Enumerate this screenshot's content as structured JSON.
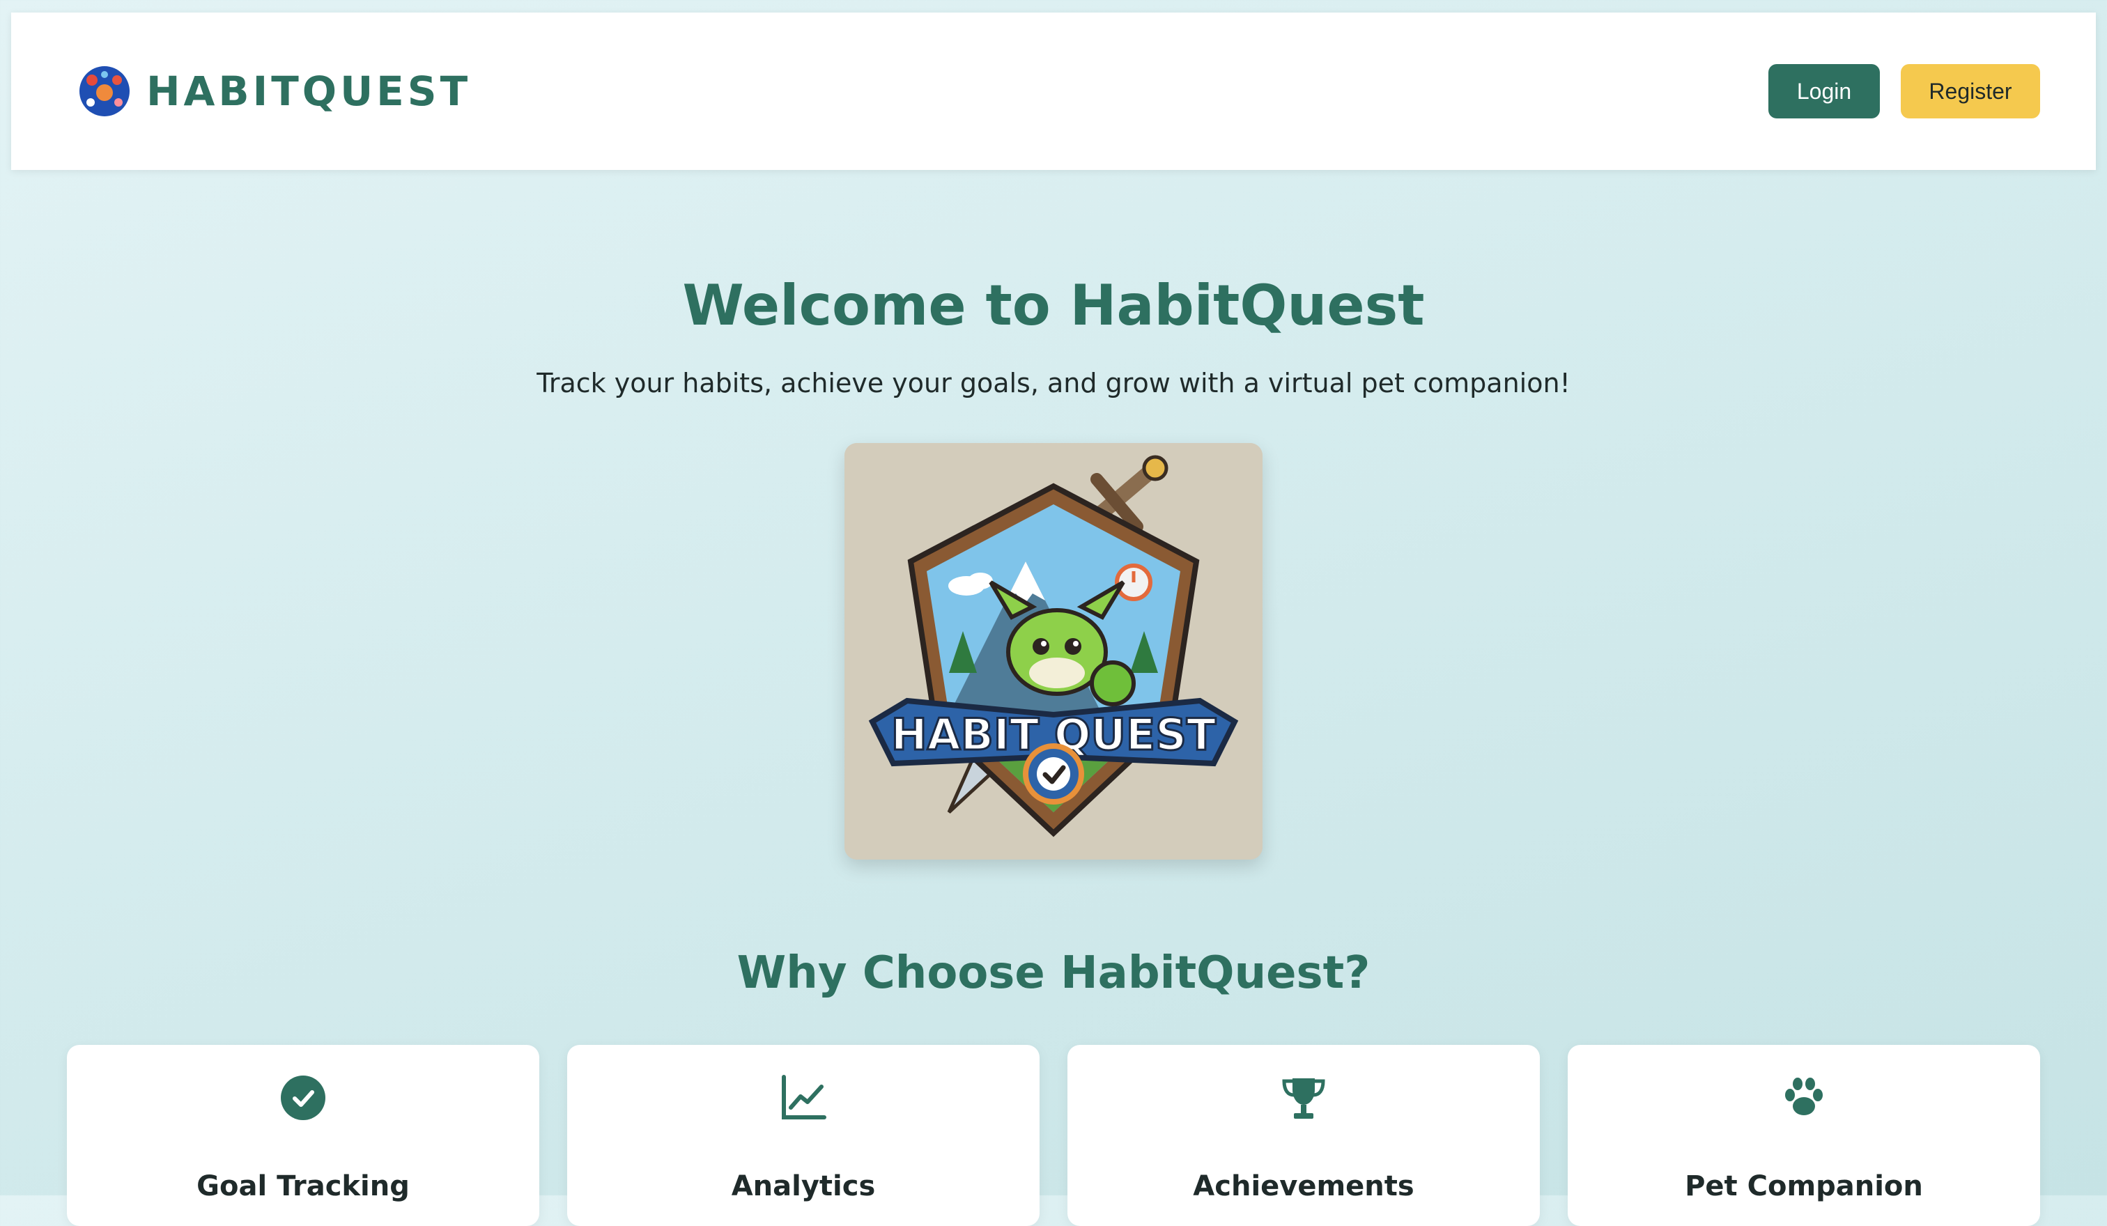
{
  "header": {
    "brand_name": "HABITQUEST",
    "login_label": "Login",
    "register_label": "Register"
  },
  "hero": {
    "title": "Welcome to HabitQuest",
    "subtitle": "Track your habits, achieve your goals, and grow with a virtual pet companion!",
    "logo_text": "HABIT QUEST",
    "logo_icon": "shield-emblem"
  },
  "features": {
    "title": "Why Choose HabitQuest?",
    "items": [
      {
        "icon": "check-circle-icon",
        "label": "Goal Tracking"
      },
      {
        "icon": "chart-line-icon",
        "label": "Analytics"
      },
      {
        "icon": "trophy-icon",
        "label": "Achievements"
      },
      {
        "icon": "paw-icon",
        "label": "Pet Companion"
      }
    ]
  },
  "colors": {
    "primary": "#2e7060",
    "accent": "#f5c94e",
    "background": "#d5ecee"
  }
}
